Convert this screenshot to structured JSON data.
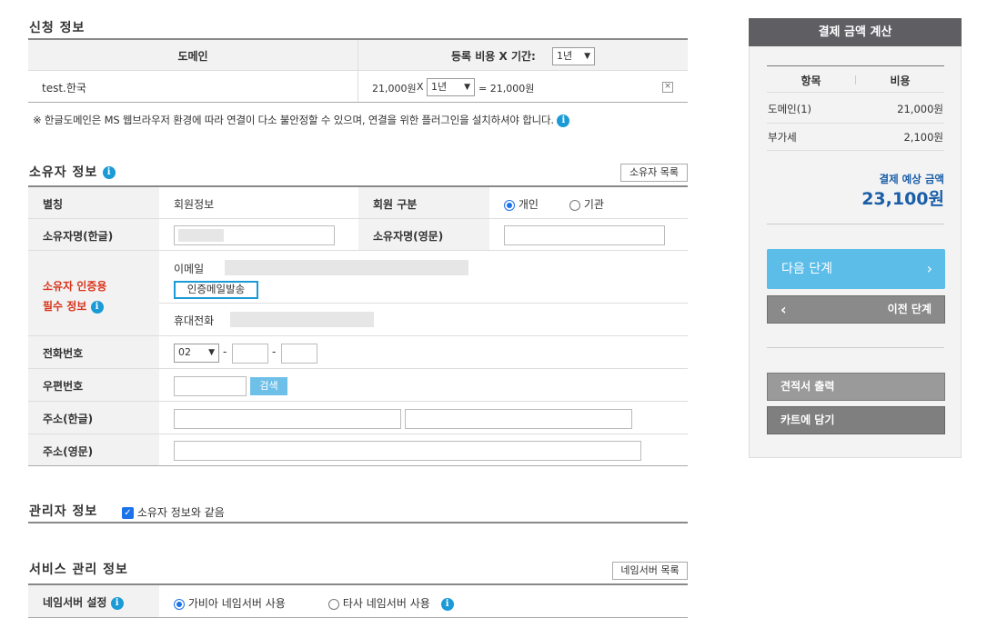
{
  "application": {
    "title": "신청 정보",
    "col_domain": "도메인",
    "col_fee_label": "등록 비용 X 기간:",
    "period_selected": "1년",
    "row_domain": "test.한국",
    "row_price": "21,000원",
    "row_times": "X",
    "row_period": "1년",
    "row_total": "= 21,000원",
    "notice": "※ 한글도메인은 MS 웹브라우저 환경에 따라 연결이 다소 불안정할 수 있으며, 연결을 위한 플러그인을 설치하셔야 합니다."
  },
  "owner": {
    "title": "소유자 정보",
    "list_button": "소유자 목록",
    "alias_label": "별칭",
    "alias_value": "회원정보",
    "member_type_label": "회원 구분",
    "type_personal": "개인",
    "type_org": "기관",
    "name_kr_label": "소유자명(한글)",
    "name_en_label": "소유자명(영문)",
    "auth_label_1": "소유자 인증용",
    "auth_label_2": "필수 정보",
    "email_label": "이메일",
    "send_auth_button": "인증메일발송",
    "mobile_label": "휴대전화",
    "phone_label": "전화번호",
    "phone_area": "02",
    "dash": "-",
    "zip_label": "우편번호",
    "search_button": "검색",
    "addr_kr_label": "주소(한글)",
    "addr_en_label": "주소(영문)"
  },
  "admin": {
    "title": "관리자 정보",
    "same_as_owner": "소유자 정보와 같음"
  },
  "service": {
    "title": "서비스 관리 정보",
    "ns_list_button": "네임서버 목록",
    "ns_label": "네임서버 설정",
    "ns_gabia": "가비아 네임서버 사용",
    "ns_other": "타사 네임서버 사용"
  },
  "summary": {
    "title": "결제 금액 계산",
    "col_item": "항목",
    "col_cost": "비용",
    "domain_label": "도메인(1)",
    "domain_cost": "21,000원",
    "vat_label": "부가세",
    "vat_cost": "2,100원",
    "expected_label": "결제 예상 금액",
    "expected_total": "23,100원",
    "next_button": "다음 단계",
    "prev_button": "이전 단계",
    "quote_button": "견적서 출력",
    "cart_button": "카트에 담기"
  },
  "colors": {
    "accent_blue": "#1a9ad6",
    "next_button": "#5bbde8",
    "auth_red": "#d9341b",
    "total_blue": "#1a5ea8"
  }
}
